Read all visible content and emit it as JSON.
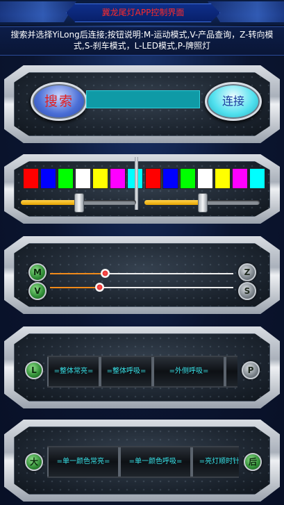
{
  "header": {
    "title": "冀龙尾灯APP控制界面",
    "notice": "搜索并选择YiLong后连接;按钮说明:M-运动模式,V-产品查询，Z-转向模式,S-刹车模式，L-LED模式,P-牌照灯"
  },
  "connect_panel": {
    "search_label": "搜索",
    "connect_label": "连接",
    "device_value": ""
  },
  "color_panel": {
    "left_swatches": [
      "#ff0000",
      "#0000ff",
      "#00ff00",
      "#ffffff",
      "#ffff00",
      "#ff00ff",
      "#00ffff"
    ],
    "right_swatches": [
      "#ff0000",
      "#0000ff",
      "#00ff00",
      "#ffffff",
      "#ffff00",
      "#ff00ff",
      "#00ffff"
    ],
    "left_brightness": 0.5,
    "right_brightness": 0.5
  },
  "mode_panel": {
    "btn_m": "M",
    "btn_v": "V",
    "btn_z": "Z",
    "btn_s": "S",
    "slider_top": 0.29,
    "slider_bottom": 0.26
  },
  "led_panel": {
    "btn_left": "L",
    "btn_right": "P",
    "effects": [
      "=整体常亮=",
      "=整体呼吸=",
      "=外侧呼吸="
    ]
  },
  "color_mode_panel": {
    "btn_left": "大",
    "btn_right": "后",
    "effects": [
      "=单一颜色常亮=",
      "=单一颜色呼吸=",
      "=亮灯顺时针"
    ]
  }
}
